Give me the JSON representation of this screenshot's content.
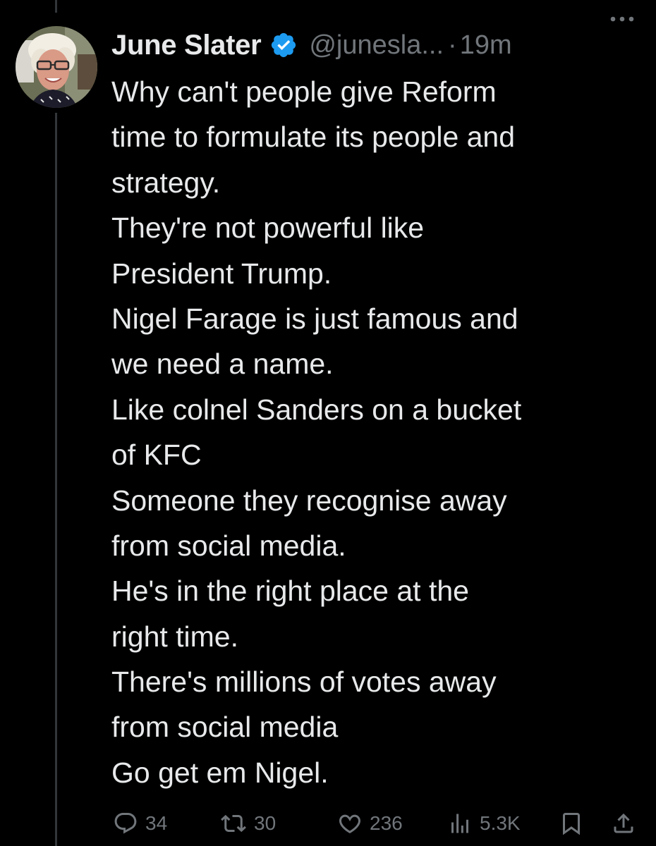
{
  "author": {
    "display_name": "June Slater",
    "handle": "@junesla...",
    "separator": "·",
    "time": "19m",
    "verified": true,
    "verified_color": "#1d9bf0",
    "avatar_icon": "profile-photo"
  },
  "tweet": {
    "lines": [
      "Why can't people give Reform",
      "time to formulate its people and",
      "strategy.",
      "They're not powerful like",
      "President Trump.",
      "Nigel Farage is just famous and",
      "we need a name.",
      "Like colnel Sanders on a bucket",
      "of KFC",
      "Someone they recognise away",
      "from social media.",
      "He's in the right place at the",
      "right time.",
      "There's millions of votes away",
      "from social media",
      "Go get em Nigel."
    ]
  },
  "actions": {
    "replies": "34",
    "reposts": "30",
    "likes": "236",
    "views": "5.3K",
    "reply_icon": "reply-icon",
    "repost_icon": "repost-icon",
    "like_icon": "heart-icon",
    "views_icon": "views-icon",
    "bookmark_icon": "bookmark-icon",
    "share_icon": "share-icon"
  },
  "colors": {
    "background": "#000000",
    "text": "#e7e9ea",
    "secondary": "#71767b",
    "thread_line": "#333639"
  }
}
